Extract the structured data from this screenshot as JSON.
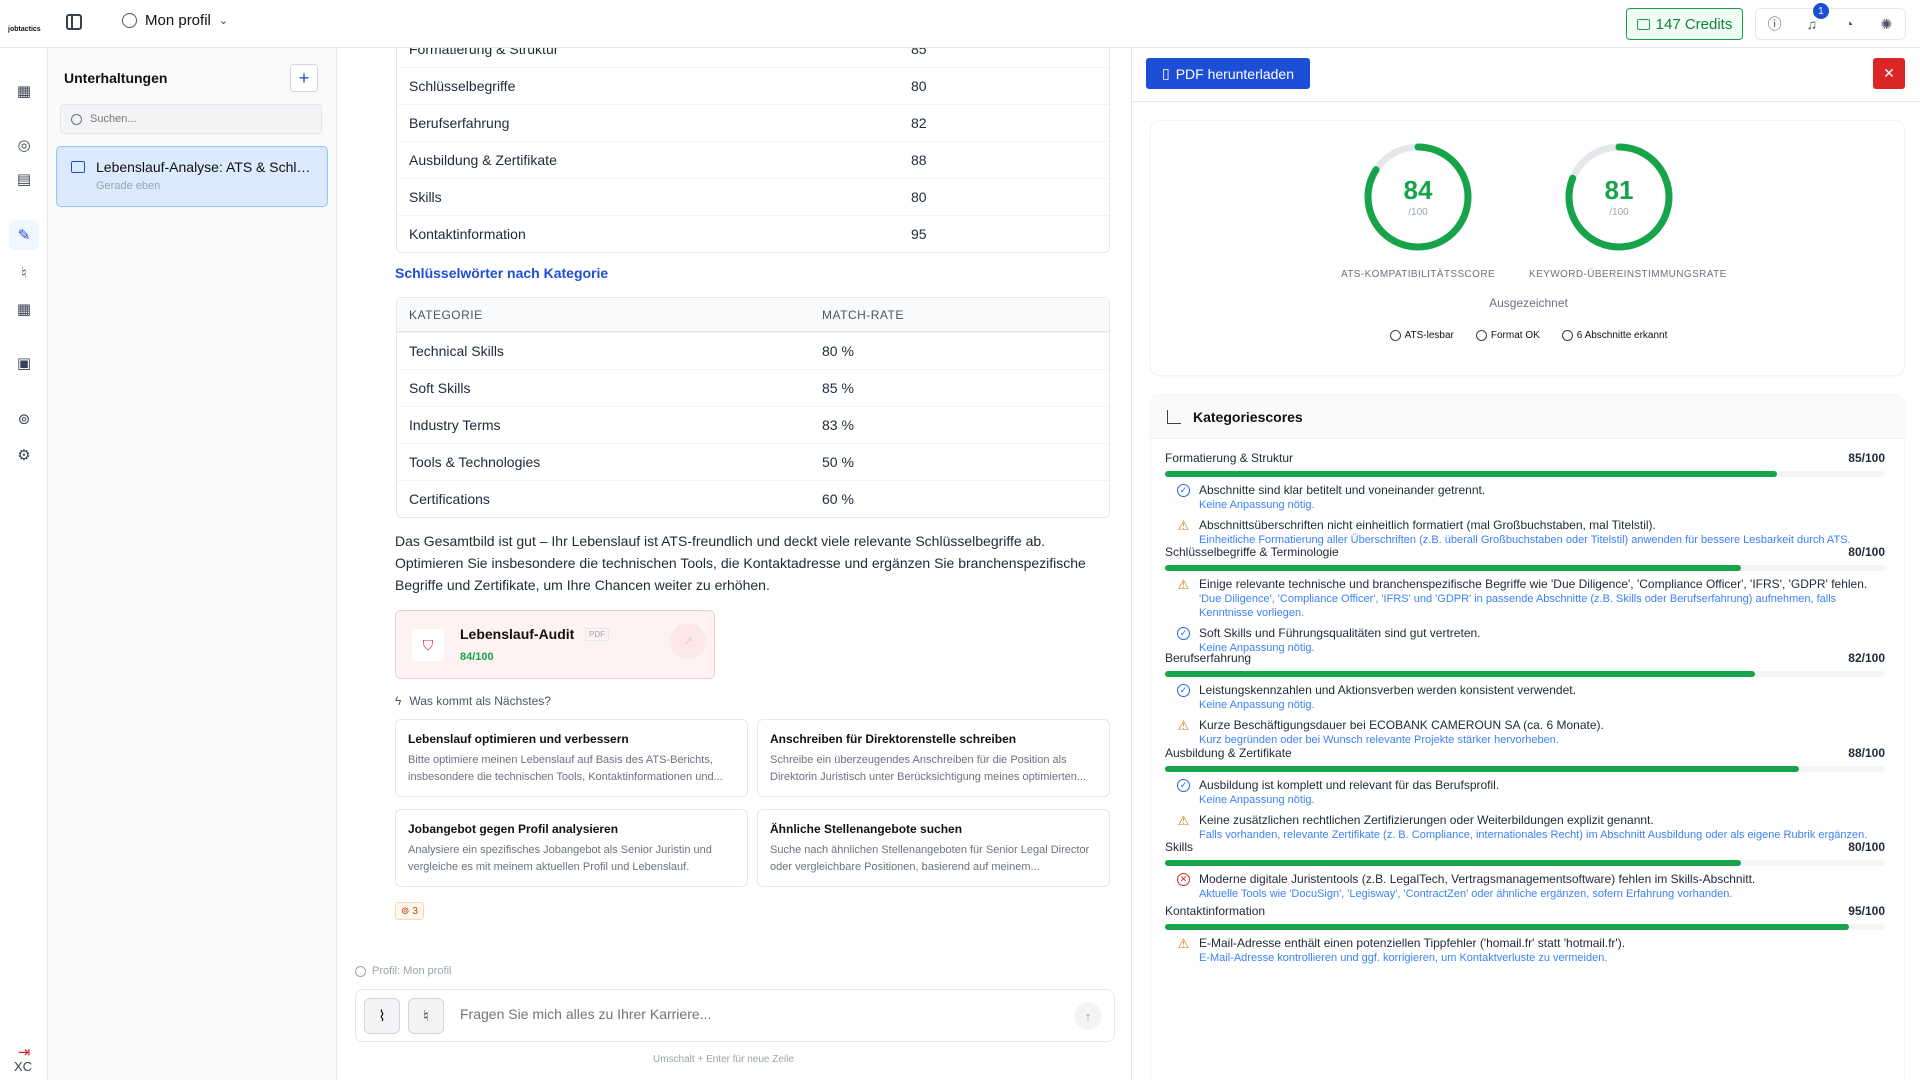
{
  "header": {
    "logo": "jobtactics",
    "profile_label": "Mon profil",
    "credits_label": "147 Credits",
    "notification_count": "1"
  },
  "rail": {
    "user_initials": "XC"
  },
  "conversations": {
    "title": "Unterhaltungen",
    "search_placeholder": "Suchen...",
    "items": [
      {
        "title": "Lebenslauf-Analyse: ATS & Schlüsselwörter",
        "subtitle": "Gerade eben"
      }
    ]
  },
  "chat": {
    "score_table": [
      {
        "label": "Formatierung & Struktur",
        "value": "85"
      },
      {
        "label": "Schlüsselbegriffe",
        "value": "80"
      },
      {
        "label": "Berufserfahrung",
        "value": "82"
      },
      {
        "label": "Ausbildung & Zertifikate",
        "value": "88"
      },
      {
        "label": "Skills",
        "value": "80"
      },
      {
        "label": "Kontaktinformation",
        "value": "95"
      }
    ],
    "keyword_title": "Schlüsselwörter nach Kategorie",
    "keyword_table": {
      "headers": [
        "KATEGORIE",
        "MATCH-RATE"
      ],
      "rows": [
        {
          "category": "Technical Skills",
          "rate": "80 %"
        },
        {
          "category": "Soft Skills",
          "rate": "85 %"
        },
        {
          "category": "Industry Terms",
          "rate": "83 %"
        },
        {
          "category": "Tools & Technologies",
          "rate": "50 %"
        },
        {
          "category": "Certifications",
          "rate": "60 %"
        }
      ]
    },
    "summary": "Das Gesamtbild ist gut – Ihr Lebenslauf ist ATS-freundlich und deckt viele relevante Schlüsselbegriffe ab. Optimieren Sie insbesondere die technischen Tools, die Kontaktadresse und ergänzen Sie branchenspezifische Begriffe und Zertifikate, um Ihre Chancen weiter zu erhöhen.",
    "audit_card": {
      "title": "Lebenslauf-Audit",
      "tag": "PDF",
      "score": "84/100"
    },
    "next_label": "Was kommt als Nächstes?",
    "suggestions": [
      {
        "title": "Lebenslauf optimieren und verbessern",
        "text": "Bitte optimiere meinen Lebenslauf auf Basis des ATS-Berichts, insbesondere die technischen Tools, Kontaktinformationen und..."
      },
      {
        "title": "Anschreiben für Direktorenstelle schreiben",
        "text": "Schreibe ein überzeugendes Anschreiben für die Position als Direktorin Juristisch unter Berücksichtigung meines optimierten..."
      },
      {
        "title": "Jobangebot gegen Profil analysieren",
        "text": "Analysiere ein spezifisches Jobangebot als Senior Juristin und vergleiche es mit meinem aktuellen Profil und Lebenslauf."
      },
      {
        "title": "Ähnliche Stellenangebote suchen",
        "text": "Suche nach ähnlichen Stellenangeboten für Senior Legal Director oder vergleichbare Positionen, basierend auf meinem..."
      }
    ],
    "credit_cost": "3",
    "profile_note": "Profil: Mon profil",
    "input_placeholder": "Fragen Sie mich alles zu Ihrer Karriere...",
    "hint": "Umschalt + Enter für neue Zeile"
  },
  "report": {
    "download_label": "PDF herunterladen",
    "gauges": [
      {
        "value": "84",
        "max": "/100",
        "label": "ATS-KOMPATIBILITÄTSSCORE",
        "fraction": 0.84
      },
      {
        "value": "81",
        "max": "/100",
        "label": "KEYWORD-ÜBEREINSTIMMUNGSRATE",
        "fraction": 0.81
      }
    ],
    "rating": "Ausgezeichnet",
    "pills": [
      "ATS-lesbar",
      "Format OK",
      "6 Abschnitte erkannt"
    ],
    "categories_title": "Kategoriescores",
    "categories": [
      {
        "name": "Formatierung & Struktur",
        "score": "85/100",
        "fraction": 0.85,
        "issues": [
          {
            "type": "ok",
            "text": "Abschnitte sind klar betitelt und voneinander getrennt.",
            "fix": "Keine Anpassung nötig."
          },
          {
            "type": "warn",
            "text": "Abschnittsüberschriften nicht einheitlich formatiert (mal Großbuchstaben, mal Titelstil).",
            "fix": "Einheitliche Formatierung aller Überschriften (z.B. überall Großbuchstaben oder Titelstil) anwenden für bessere Lesbarkeit durch ATS."
          }
        ]
      },
      {
        "name": "Schlüsselbegriffe & Terminologie",
        "score": "80/100",
        "fraction": 0.8,
        "issues": [
          {
            "type": "warn",
            "text": "Einige relevante technische und branchenspezifische Begriffe wie 'Due Diligence', 'Compliance Officer', 'IFRS', 'GDPR' fehlen.",
            "fix": "'Due Diligence', 'Compliance Officer', 'IFRS' und 'GDPR' in passende Abschnitte (z.B. Skills oder Berufserfahrung) aufnehmen, falls Kenntnisse vorliegen."
          },
          {
            "type": "ok",
            "text": "Soft Skills und Führungsqualitäten sind gut vertreten.",
            "fix": "Keine Anpassung nötig."
          }
        ]
      },
      {
        "name": "Berufserfahrung",
        "score": "82/100",
        "fraction": 0.82,
        "issues": [
          {
            "type": "ok",
            "text": "Leistungskennzahlen und Aktionsverben werden konsistent verwendet.",
            "fix": "Keine Anpassung nötig."
          },
          {
            "type": "warn",
            "text": "Kurze Beschäftigungsdauer bei ECOBANK CAMEROUN SA (ca. 6 Monate).",
            "fix": "Kurz begründen oder bei Wunsch relevante Projekte stärker hervorheben."
          }
        ]
      },
      {
        "name": "Ausbildung & Zertifikate",
        "score": "88/100",
        "fraction": 0.88,
        "issues": [
          {
            "type": "ok",
            "text": "Ausbildung ist komplett und relevant für das Berufsprofil.",
            "fix": "Keine Anpassung nötig."
          },
          {
            "type": "warn",
            "text": "Keine zusätzlichen rechtlichen Zertifizierungen oder Weiterbildungen explizit genannt.",
            "fix": "Falls vorhanden, relevante Zertifikate (z. B. Compliance, internationales Recht) im Abschnitt Ausbildung oder als eigene Rubrik ergänzen."
          }
        ]
      },
      {
        "name": "Skills",
        "score": "80/100",
        "fraction": 0.8,
        "issues": [
          {
            "type": "err",
            "text": "Moderne digitale Juristentools (z.B. LegalTech, Vertragsmanagementsoftware) fehlen im Skills-Abschnitt.",
            "fix": "Aktuelle Tools wie 'DocuSign', 'Legisway', 'ContractZen' oder ähnliche ergänzen, sofern Erfahrung vorhanden."
          }
        ]
      },
      {
        "name": "Kontaktinformation",
        "score": "95/100",
        "fraction": 0.95,
        "issues": [
          {
            "type": "warn",
            "text": "E-Mail-Adresse enthält einen potenziellen Tippfehler ('homail.fr' statt 'hotmail.fr').",
            "fix": "E-Mail-Adresse kontrollieren und ggf. korrigieren, um Kontaktverluste zu vermeiden."
          }
        ]
      }
    ],
    "colors": {
      "accent": "#1d4ed8",
      "success": "#16a34a",
      "warning": "#d97706",
      "error": "#dc2626"
    }
  }
}
